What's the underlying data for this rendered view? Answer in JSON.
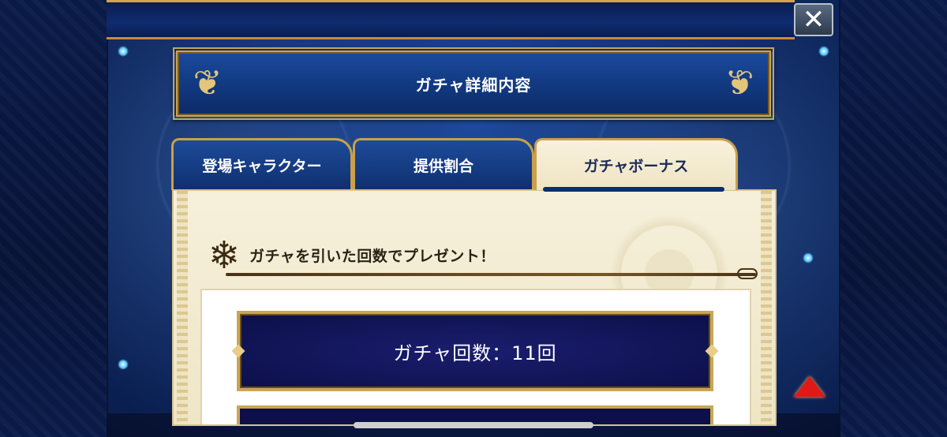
{
  "dialog": {
    "title": "ガチャ詳細内容",
    "close_label": "✕"
  },
  "tabs": [
    {
      "label": "登場キャラクター",
      "active": false
    },
    {
      "label": "提供割合",
      "active": false
    },
    {
      "label": "ガチャボーナス",
      "active": true
    }
  ],
  "bonus": {
    "section_title": "ガチャを引いた回数でプレゼント！",
    "count_label": "ガチャ回数：11回"
  },
  "colors": {
    "gold_border": "#c9a555",
    "navy_plate": "#0c0f48",
    "parchment": "#f6f0db",
    "scroll_arrow": "#e01818"
  },
  "icons": {
    "close": "close-icon",
    "section": "snowflake-emblem-icon",
    "scroll": "scroll-up-arrow-icon"
  }
}
